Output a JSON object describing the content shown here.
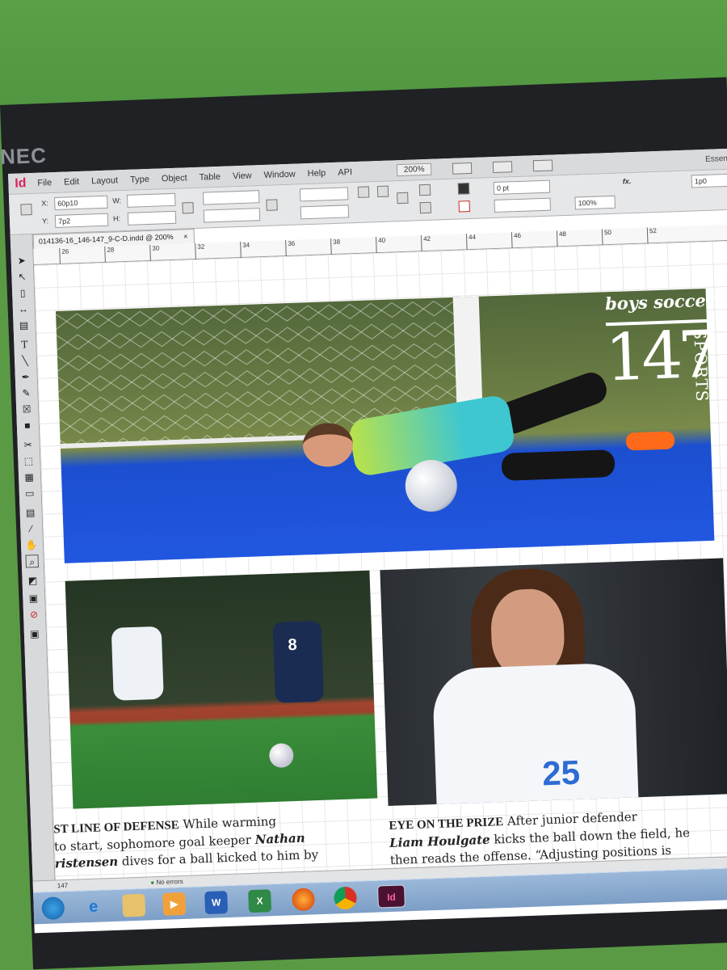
{
  "monitor": {
    "brand": "NEC"
  },
  "app": {
    "logo": "Id",
    "menu": [
      "File",
      "Edit",
      "Layout",
      "Type",
      "Object",
      "Table",
      "View",
      "Window",
      "Help",
      "API"
    ],
    "zoom": "200%",
    "workspace": "Essenti"
  },
  "control": {
    "x_label": "X:",
    "x_value": "60p10",
    "y_label": "Y:",
    "y_value": "7p2",
    "w_label": "W:",
    "h_label": "H:",
    "stroke_weight": "0 pt",
    "scale": "100%",
    "gap": "1p0"
  },
  "document": {
    "tab_title": "014136-16_146-147_9-C-D.indd @ 200%",
    "tab_close": "×",
    "ruler_ticks": [
      "26",
      "28",
      "30",
      "32",
      "34",
      "36",
      "38",
      "40",
      "42",
      "44",
      "46",
      "48",
      "50",
      "52"
    ]
  },
  "spread": {
    "masthead_title": "boys soccer",
    "page_number": "147",
    "section": "SPORTS",
    "jersey_left": "8",
    "jersey_right": "25",
    "caption_left": {
      "heading": "ST LINE OF DEFENSE",
      "line1": "While warming",
      "line2a": "to start, sophomore goal keeper",
      "name1": "Nathan",
      "name2": "ristensen",
      "line3": "dives for a ball kicked to him by"
    },
    "caption_right": {
      "heading": "EYE ON THE PRIZE",
      "line1": "After junior defender",
      "name": "Liam Houlgate",
      "line2": "kicks the ball down the field, he",
      "line3": "then reads the offense. “Adjusting positions is"
    }
  },
  "statusbar": {
    "page": "147",
    "errors": "No errors"
  },
  "taskbar": {
    "apps": [
      "start",
      "ie",
      "explorer",
      "media",
      "word",
      "excel",
      "firefox",
      "chrome",
      "indesign"
    ],
    "word_label": "W",
    "excel_label": "X",
    "indesign_label": "Id"
  }
}
